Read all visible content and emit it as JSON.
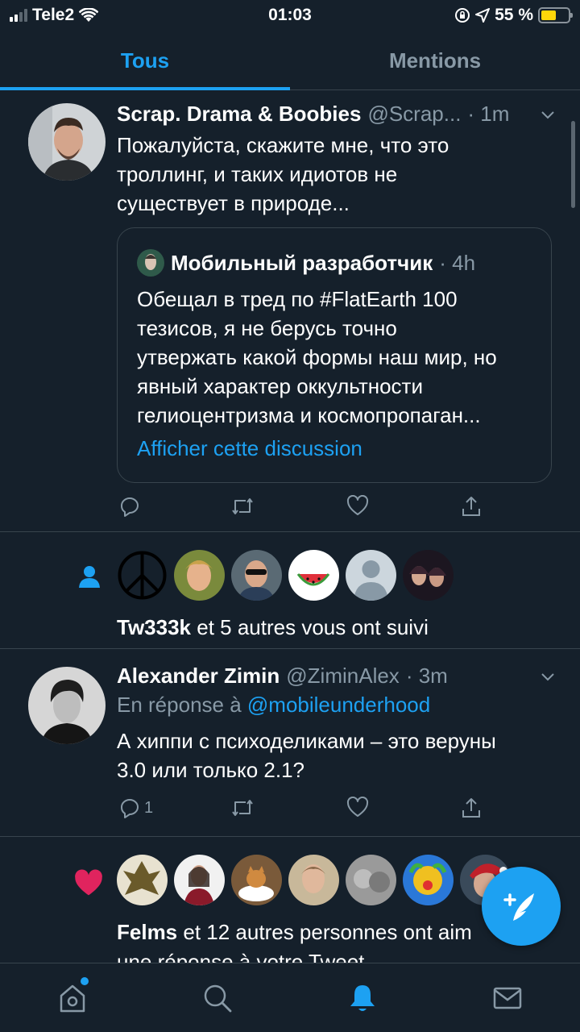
{
  "status_bar": {
    "carrier": "Tele2",
    "time": "01:03",
    "battery_percent": "55 %",
    "battery_level": 0.55
  },
  "tabs": [
    {
      "label": "Tous",
      "active": true
    },
    {
      "label": "Mentions",
      "active": false
    }
  ],
  "tweet1": {
    "name": "Scrap. Drama & Boobies",
    "handle": "@Scrap...",
    "time": "· 1m",
    "text_lines": [
      "Пожалуйста, скажите мне, что это",
      "троллинг, и таких идиотов не",
      "существует в природе..."
    ],
    "quote": {
      "name": "Мобильный разработчик",
      "time": "· 4h",
      "text_lines": [
        "Обещал в тред по #FlatEarth 100",
        "тезисов, я не берусь точно",
        "утвержать какой формы наш мир, но",
        "явный характер оккультности",
        "гелиоцентризма и космопропаган..."
      ],
      "link": "Afficher cette discussion"
    }
  },
  "follow_activity": {
    "icon": "person-icon",
    "user": "Tw333k",
    "rest": " et 5 autres vous ont suivi"
  },
  "tweet2": {
    "name": "Alexander Zimin",
    "handle": "@ZiminAlex",
    "time": "· 3m",
    "reply_prefix": "En réponse à ",
    "reply_mention": "@mobileunderhood",
    "text_lines": [
      "А хиппи с психоделиками – это веруны",
      "3.0 или только 2.1?"
    ],
    "reply_count": "1"
  },
  "like_activity": {
    "icon": "heart-icon",
    "user": "Felms",
    "rest_line1": " et 12 autres personnes ont aim",
    "line2": "une réponse à votre Tweet"
  },
  "colors": {
    "background": "#15202b",
    "accent": "#1da1f2",
    "secondary_text": "#8899a6",
    "divider": "#38444d",
    "like": "#e0245e"
  },
  "bottom_nav": [
    "home-icon",
    "search-icon",
    "notifications-icon",
    "messages-icon"
  ]
}
